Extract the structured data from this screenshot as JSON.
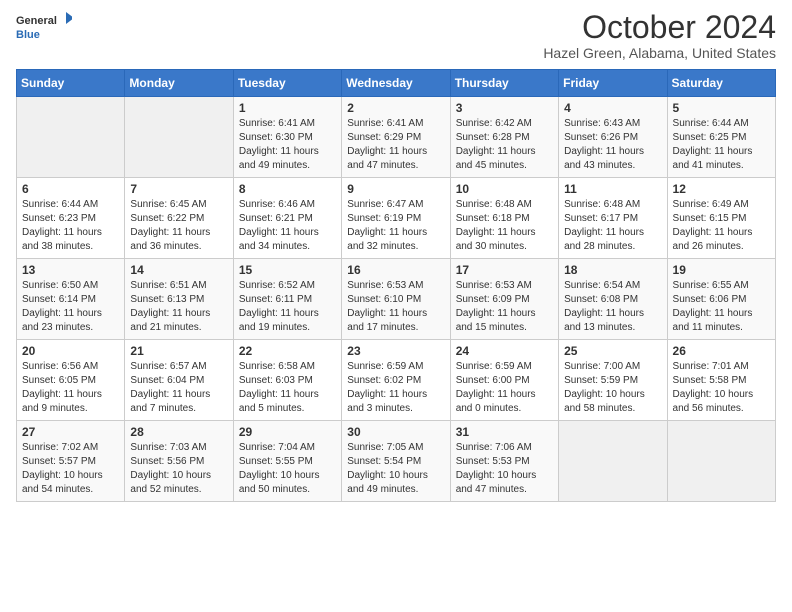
{
  "logo": {
    "general": "General",
    "blue": "Blue"
  },
  "title": "October 2024",
  "subtitle": "Hazel Green, Alabama, United States",
  "headers": [
    "Sunday",
    "Monday",
    "Tuesday",
    "Wednesday",
    "Thursday",
    "Friday",
    "Saturday"
  ],
  "weeks": [
    [
      {
        "num": "",
        "lines": []
      },
      {
        "num": "",
        "lines": []
      },
      {
        "num": "1",
        "lines": [
          "Sunrise: 6:41 AM",
          "Sunset: 6:30 PM",
          "Daylight: 11 hours and 49 minutes."
        ]
      },
      {
        "num": "2",
        "lines": [
          "Sunrise: 6:41 AM",
          "Sunset: 6:29 PM",
          "Daylight: 11 hours and 47 minutes."
        ]
      },
      {
        "num": "3",
        "lines": [
          "Sunrise: 6:42 AM",
          "Sunset: 6:28 PM",
          "Daylight: 11 hours and 45 minutes."
        ]
      },
      {
        "num": "4",
        "lines": [
          "Sunrise: 6:43 AM",
          "Sunset: 6:26 PM",
          "Daylight: 11 hours and 43 minutes."
        ]
      },
      {
        "num": "5",
        "lines": [
          "Sunrise: 6:44 AM",
          "Sunset: 6:25 PM",
          "Daylight: 11 hours and 41 minutes."
        ]
      }
    ],
    [
      {
        "num": "6",
        "lines": [
          "Sunrise: 6:44 AM",
          "Sunset: 6:23 PM",
          "Daylight: 11 hours and 38 minutes."
        ]
      },
      {
        "num": "7",
        "lines": [
          "Sunrise: 6:45 AM",
          "Sunset: 6:22 PM",
          "Daylight: 11 hours and 36 minutes."
        ]
      },
      {
        "num": "8",
        "lines": [
          "Sunrise: 6:46 AM",
          "Sunset: 6:21 PM",
          "Daylight: 11 hours and 34 minutes."
        ]
      },
      {
        "num": "9",
        "lines": [
          "Sunrise: 6:47 AM",
          "Sunset: 6:19 PM",
          "Daylight: 11 hours and 32 minutes."
        ]
      },
      {
        "num": "10",
        "lines": [
          "Sunrise: 6:48 AM",
          "Sunset: 6:18 PM",
          "Daylight: 11 hours and 30 minutes."
        ]
      },
      {
        "num": "11",
        "lines": [
          "Sunrise: 6:48 AM",
          "Sunset: 6:17 PM",
          "Daylight: 11 hours and 28 minutes."
        ]
      },
      {
        "num": "12",
        "lines": [
          "Sunrise: 6:49 AM",
          "Sunset: 6:15 PM",
          "Daylight: 11 hours and 26 minutes."
        ]
      }
    ],
    [
      {
        "num": "13",
        "lines": [
          "Sunrise: 6:50 AM",
          "Sunset: 6:14 PM",
          "Daylight: 11 hours and 23 minutes."
        ]
      },
      {
        "num": "14",
        "lines": [
          "Sunrise: 6:51 AM",
          "Sunset: 6:13 PM",
          "Daylight: 11 hours and 21 minutes."
        ]
      },
      {
        "num": "15",
        "lines": [
          "Sunrise: 6:52 AM",
          "Sunset: 6:11 PM",
          "Daylight: 11 hours and 19 minutes."
        ]
      },
      {
        "num": "16",
        "lines": [
          "Sunrise: 6:53 AM",
          "Sunset: 6:10 PM",
          "Daylight: 11 hours and 17 minutes."
        ]
      },
      {
        "num": "17",
        "lines": [
          "Sunrise: 6:53 AM",
          "Sunset: 6:09 PM",
          "Daylight: 11 hours and 15 minutes."
        ]
      },
      {
        "num": "18",
        "lines": [
          "Sunrise: 6:54 AM",
          "Sunset: 6:08 PM",
          "Daylight: 11 hours and 13 minutes."
        ]
      },
      {
        "num": "19",
        "lines": [
          "Sunrise: 6:55 AM",
          "Sunset: 6:06 PM",
          "Daylight: 11 hours and 11 minutes."
        ]
      }
    ],
    [
      {
        "num": "20",
        "lines": [
          "Sunrise: 6:56 AM",
          "Sunset: 6:05 PM",
          "Daylight: 11 hours and 9 minutes."
        ]
      },
      {
        "num": "21",
        "lines": [
          "Sunrise: 6:57 AM",
          "Sunset: 6:04 PM",
          "Daylight: 11 hours and 7 minutes."
        ]
      },
      {
        "num": "22",
        "lines": [
          "Sunrise: 6:58 AM",
          "Sunset: 6:03 PM",
          "Daylight: 11 hours and 5 minutes."
        ]
      },
      {
        "num": "23",
        "lines": [
          "Sunrise: 6:59 AM",
          "Sunset: 6:02 PM",
          "Daylight: 11 hours and 3 minutes."
        ]
      },
      {
        "num": "24",
        "lines": [
          "Sunrise: 6:59 AM",
          "Sunset: 6:00 PM",
          "Daylight: 11 hours and 0 minutes."
        ]
      },
      {
        "num": "25",
        "lines": [
          "Sunrise: 7:00 AM",
          "Sunset: 5:59 PM",
          "Daylight: 10 hours and 58 minutes."
        ]
      },
      {
        "num": "26",
        "lines": [
          "Sunrise: 7:01 AM",
          "Sunset: 5:58 PM",
          "Daylight: 10 hours and 56 minutes."
        ]
      }
    ],
    [
      {
        "num": "27",
        "lines": [
          "Sunrise: 7:02 AM",
          "Sunset: 5:57 PM",
          "Daylight: 10 hours and 54 minutes."
        ]
      },
      {
        "num": "28",
        "lines": [
          "Sunrise: 7:03 AM",
          "Sunset: 5:56 PM",
          "Daylight: 10 hours and 52 minutes."
        ]
      },
      {
        "num": "29",
        "lines": [
          "Sunrise: 7:04 AM",
          "Sunset: 5:55 PM",
          "Daylight: 10 hours and 50 minutes."
        ]
      },
      {
        "num": "30",
        "lines": [
          "Sunrise: 7:05 AM",
          "Sunset: 5:54 PM",
          "Daylight: 10 hours and 49 minutes."
        ]
      },
      {
        "num": "31",
        "lines": [
          "Sunrise: 7:06 AM",
          "Sunset: 5:53 PM",
          "Daylight: 10 hours and 47 minutes."
        ]
      },
      {
        "num": "",
        "lines": []
      },
      {
        "num": "",
        "lines": []
      }
    ]
  ]
}
